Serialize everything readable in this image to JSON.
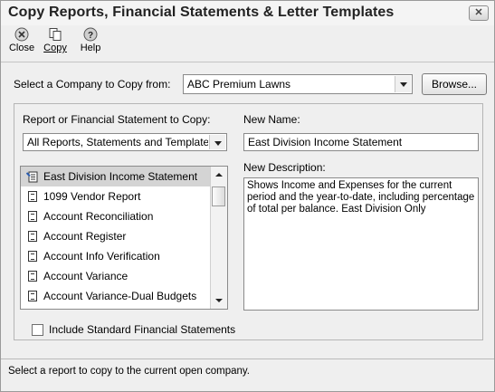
{
  "window": {
    "title": "Copy Reports, Financial Statements & Letter Templates",
    "close_glyph": "✕"
  },
  "toolbar": {
    "close_label": "Close",
    "copy_label": "Copy",
    "help_label": "Help"
  },
  "company": {
    "label": "Select a Company to Copy from:",
    "value": "ABC Premium Lawns",
    "browse_label": "Browse..."
  },
  "report": {
    "label": "Report or Financial Statement to Copy:",
    "filter_value": "All Reports, Statements and Templates",
    "items": [
      {
        "label": "East Division Income Statement",
        "icon": "custom-report-icon",
        "selected": true
      },
      {
        "label": "1099 Vendor Report",
        "icon": "document-icon",
        "selected": false
      },
      {
        "label": "Account  Reconciliation",
        "icon": "document-icon",
        "selected": false
      },
      {
        "label": "Account  Register",
        "icon": "document-icon",
        "selected": false
      },
      {
        "label": "Account Info Verification",
        "icon": "document-icon",
        "selected": false
      },
      {
        "label": "Account Variance",
        "icon": "document-icon",
        "selected": false
      },
      {
        "label": "Account Variance-Dual Budgets",
        "icon": "document-icon",
        "selected": false
      }
    ],
    "include_standard_label": "Include Standard Financial Statements"
  },
  "new_name": {
    "label": "New Name:",
    "value": "East Division Income Statement"
  },
  "new_description": {
    "label": "New Description:",
    "value": "Shows Income and Expenses for the current period and the year-to-date, including percentage of total per balance. East Division Only"
  },
  "status": {
    "text": "Select a report to copy to the current open company."
  }
}
